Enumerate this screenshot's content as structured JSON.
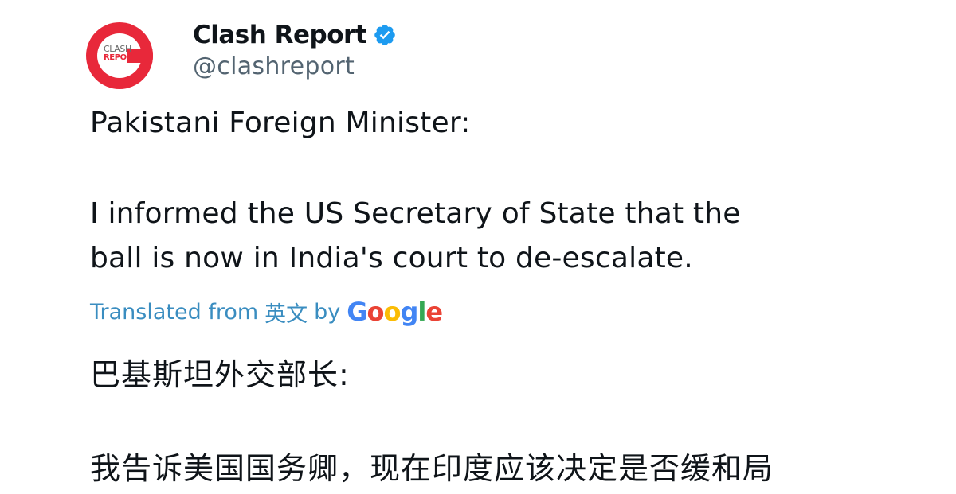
{
  "tweet": {
    "author": {
      "display_name": "Clash Report",
      "handle": "@clashreport",
      "avatar_text_top": "CLASH",
      "avatar_text_bottom": "REPORT",
      "verified_icon": "verified-badge-icon"
    },
    "text_lines": [
      "Pakistani Foreign Minister:",
      "I informed the US Secretary of State that the",
      "ball is now in India's court to de-escalate."
    ],
    "translation": {
      "label_prefix": "Translated from",
      "source_language": "英文",
      "by_label": "by",
      "provider": "Google",
      "provider_letters": [
        "G",
        "o",
        "o",
        "g",
        "l",
        "e"
      ]
    },
    "translated_lines": [
      "巴基斯坦外交部长:",
      "我告诉美国国务卿，现在印度应该决定是否缓和局"
    ]
  },
  "colors": {
    "avatar_red": "#e8283a",
    "verified_blue": "#1d9bf0",
    "handle_gray": "#536471",
    "translated_link": "#3a8dc0",
    "google_blue": "#4285f4",
    "google_red": "#ea4335",
    "google_yellow": "#fbbc05",
    "google_green": "#34a853"
  }
}
